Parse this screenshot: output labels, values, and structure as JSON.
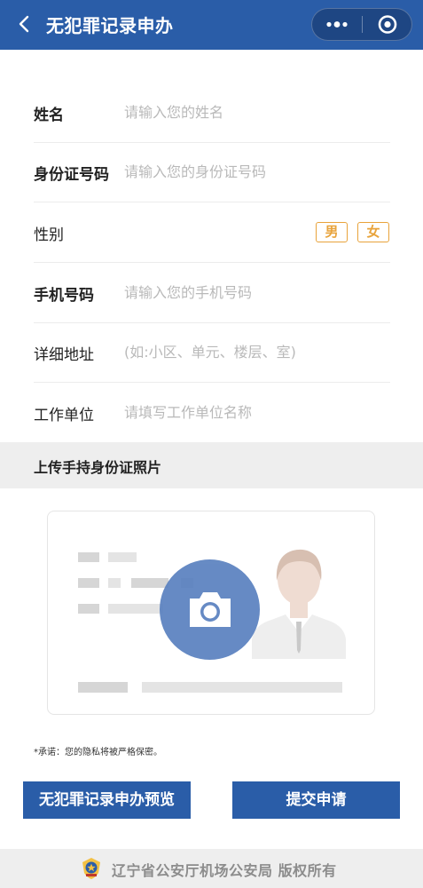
{
  "header": {
    "title": "无犯罪记录申办"
  },
  "form": {
    "name": {
      "label": "姓名",
      "placeholder": "请输入您的姓名"
    },
    "id_number": {
      "label": "身份证号码",
      "placeholder": "请输入您的身份证号码"
    },
    "gender": {
      "label": "性别",
      "male": "男",
      "female": "女"
    },
    "phone": {
      "label": "手机号码",
      "placeholder": "请输入您的手机号码"
    },
    "address": {
      "label": "详细地址",
      "placeholder": "(如:小区、单元、楼层、室)"
    },
    "employer": {
      "label": "工作单位",
      "placeholder": "请填写工作单位名称"
    }
  },
  "upload": {
    "section_title": "上传手持身份证照片"
  },
  "promise": "*承诺：您的隐私将被严格保密。",
  "buttons": {
    "preview": "无犯罪记录申办预览",
    "submit": "提交申请"
  },
  "footer": {
    "copyright": "辽宁省公安厅机场公安局 版权所有"
  },
  "colors": {
    "primary": "#2a5da8",
    "accent": "#e8a33b",
    "camera": "#5b82c0"
  }
}
